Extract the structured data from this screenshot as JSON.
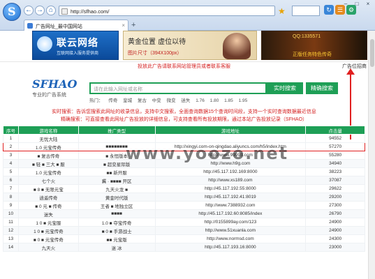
{
  "browser": {
    "address": "http://sfhao.com/",
    "tab_title": "广告网址_最中国网站",
    "new_tab": "+"
  },
  "ads": {
    "ad1_title": "联云网络",
    "ad1_sub": "互联网接入服务提供商",
    "ad2_title": "黄金位置 虚位以待",
    "ad2_size": "图片尺寸（394X100px）",
    "ad3_line1": "QQ:1335571",
    "ad3_line2": "正版任务特色传奇"
  },
  "notice": "投放此广告请联系网站管理员或者联系客服",
  "adv_link": "广告位招商",
  "brand": {
    "name": "SFHAO",
    "tagline": "专业的广告系统"
  },
  "search": {
    "placeholder": "请在此输入网址或名称",
    "btn1": "实时搜索",
    "btn2": "精确搜索",
    "hot_label": "热门：",
    "hot": [
      "传奇",
      "皇城",
      "复古",
      "中变",
      "微变",
      "迷失",
      "1.76",
      "1.80",
      "1.85",
      "1.95"
    ]
  },
  "red1": "实时搜索：告诉您搜索此网址的收录信息，支持中文搜索，全面查询数据15个查询时间段，支持一个实时查询数据最近信息",
  "red2": "精确搜索：可直接查看此网址广告投放的详细信息，可支持查看所有投放期限，通过本站广告投放记录（SFHAO）",
  "table": {
    "headers": [
      "序号",
      "游戏名称",
      "推广类型",
      "游戏地址",
      "点击量"
    ],
    "rows": [
      [
        "1",
        "无忧大陆",
        "",
        "",
        "94552"
      ],
      [
        "2",
        "1.0 元宝传奇",
        "■■■■■■■■",
        "http://xingyi.com-on-qingdao.aliyuncs.com/h5/index.htm",
        "57270"
      ],
      [
        "3",
        "■ 复古传奇",
        "■ 永恒版本",
        "http://www.99993.com",
        "55280"
      ],
      [
        "4",
        "■ 轻 ■ 三大 ■ 服",
        "■ 超变星际版",
        "http://www.h9g.com",
        "34940"
      ],
      [
        "5",
        "1.0 元宝传奇",
        "■■ 新开服",
        "http://45.117.192.169:8000",
        "38223"
      ],
      [
        "6",
        "七个火",
        "冀 · ■■■■ 开区",
        "http://www.xs189.com",
        "37087"
      ],
      [
        "7",
        "■ 8 ■ 无限元宝",
        "九天火龙 ■",
        "http://45.117.192.55:8000",
        "29622"
      ],
      [
        "8",
        "逍遥传奇",
        "黄金时代版",
        "http://45.117.192.41:8019",
        "29200"
      ],
      [
        "9",
        "■ 0 元 ■ 传奇",
        "王者 ■ 地独立区",
        "http://www.7388932.com",
        "27300"
      ],
      [
        "10",
        "迷失",
        "■■■■",
        "http://45.117.192.60:8085/index",
        "26790"
      ],
      [
        "11",
        "1 0 ■ 元宝服",
        "1.0 ■ 夺宝传奇",
        "http://0155899ay.com/123",
        "24900"
      ],
      [
        "12",
        "1 0 ■ 元宝传奇",
        "■ 0 ■ 手游战士",
        "http://www.51xuanla.com",
        "24900"
      ],
      [
        "13",
        "■ 0 ■ 元宝传奇",
        "■■ 元宝版",
        "http://www.normsd.com",
        "24300"
      ],
      [
        "14",
        "九天火",
        "迷 冰",
        "http://45.117.193.16:8000",
        "23000"
      ]
    ]
  },
  "watermark": "www.yoozo.net"
}
